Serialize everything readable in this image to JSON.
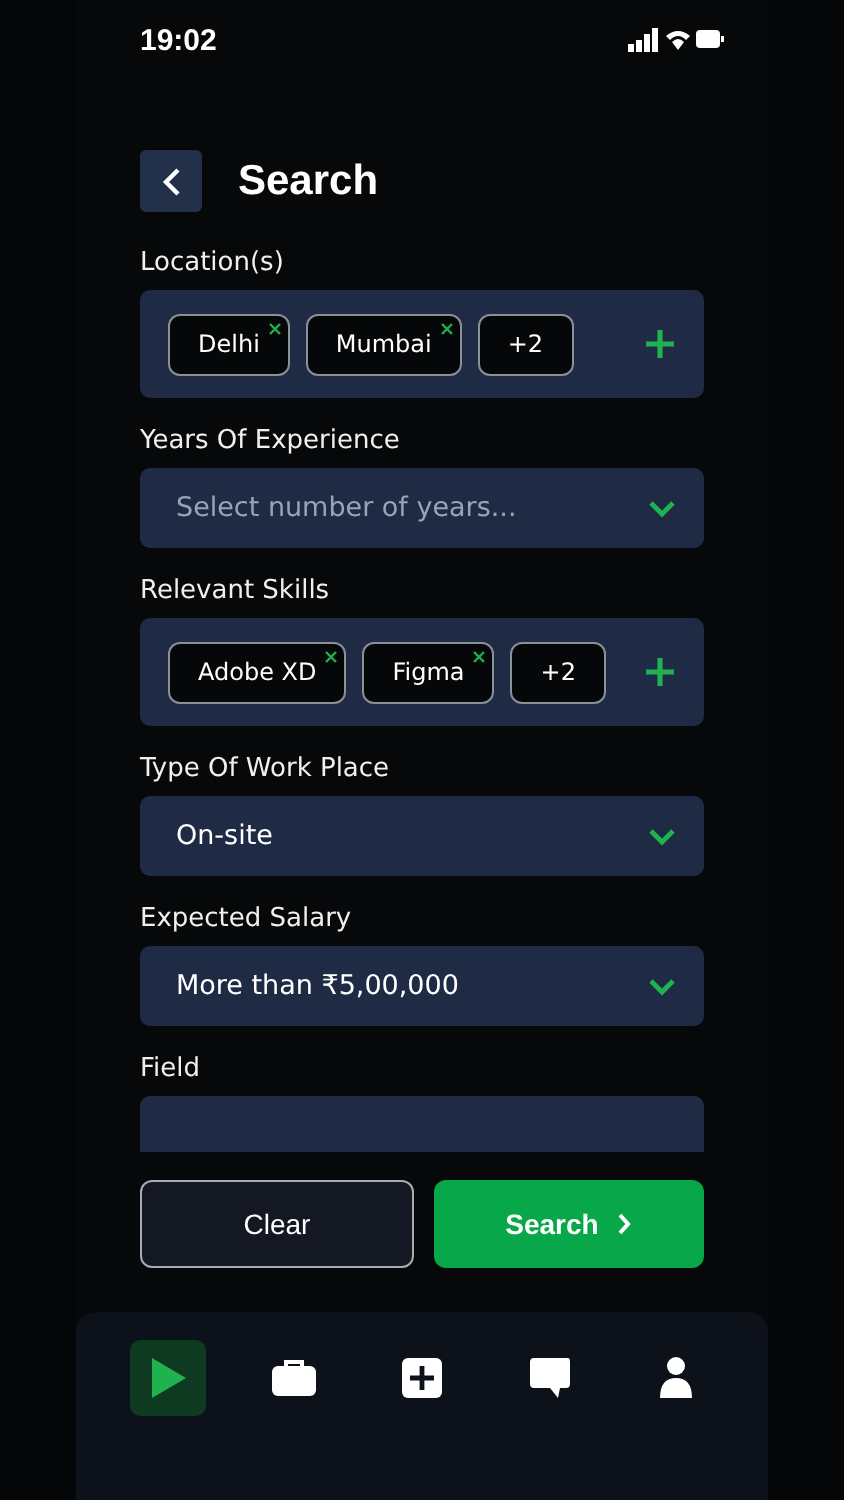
{
  "status_bar": {
    "time": "19:02"
  },
  "header": {
    "title": "Search"
  },
  "fields": [
    {
      "kind": "tags",
      "label": "Location(s)",
      "tags": [
        {
          "text": "Delhi",
          "removable": true
        },
        {
          "text": "Mumbai",
          "removable": true
        },
        {
          "text": "+2",
          "removable": false
        }
      ]
    },
    {
      "kind": "select",
      "label": "Years Of Experience",
      "placeholder": "Select number of years..."
    },
    {
      "kind": "tags",
      "label": "Relevant Skills",
      "tags": [
        {
          "text": "Adobe XD",
          "removable": true
        },
        {
          "text": "Figma",
          "removable": true
        },
        {
          "text": "+2",
          "removable": false
        }
      ]
    },
    {
      "kind": "select",
      "label": "Type  Of Work Place",
      "value": "On-site"
    },
    {
      "kind": "select",
      "label": "Expected Salary",
      "value": "More than ₹5,00,000"
    },
    {
      "kind": "cut",
      "label": "Field"
    }
  ],
  "buttons": [
    {
      "kind": "secondary",
      "label": "Clear"
    },
    {
      "kind": "primary",
      "label": "Search"
    }
  ],
  "nav": [
    {
      "selected": true
    },
    {
      "selected": false
    },
    {
      "selected": false
    },
    {
      "selected": false
    },
    {
      "selected": false
    }
  ]
}
